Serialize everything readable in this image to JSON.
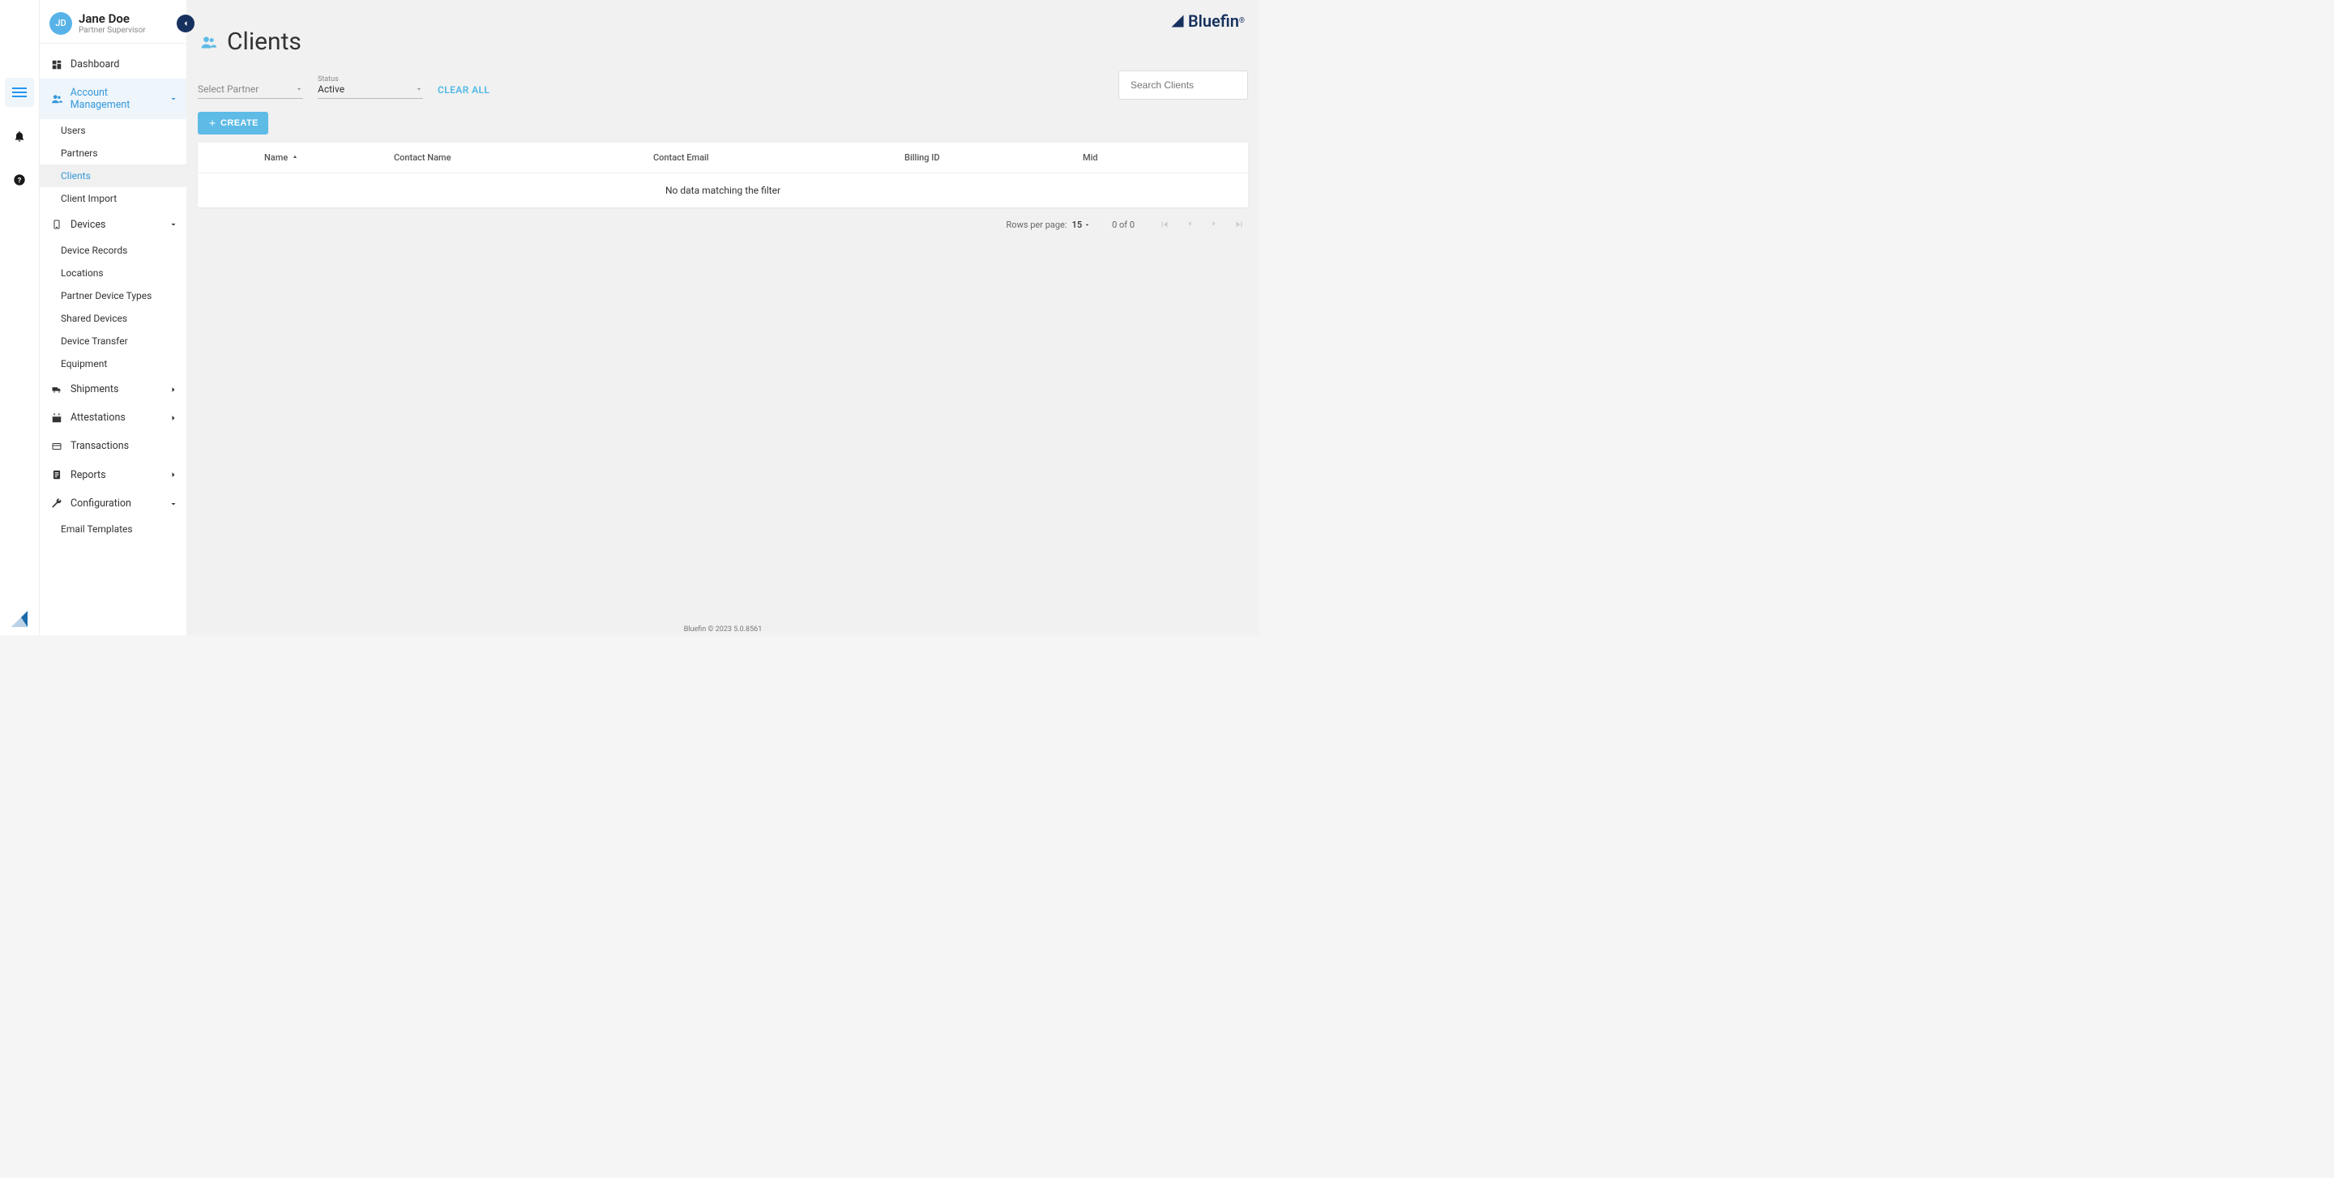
{
  "left_rail": {},
  "user": {
    "initials": "JD",
    "name": "Jane Doe",
    "role": "Partner Supervisor"
  },
  "sidebar": {
    "dashboard": "Dashboard",
    "account_mgmt": {
      "label": "Account Management",
      "items": [
        "Users",
        "Partners",
        "Clients",
        "Client Import"
      ]
    },
    "devices": {
      "label": "Devices",
      "items": [
        "Device Records",
        "Locations",
        "Partner Device Types",
        "Shared Devices",
        "Device Transfer",
        "Equipment"
      ]
    },
    "shipments": "Shipments",
    "attestations": "Attestations",
    "transactions": "Transactions",
    "reports": "Reports",
    "configuration": {
      "label": "Configuration",
      "items": [
        "Email Templates"
      ]
    }
  },
  "page": {
    "title": "Clients",
    "brand": "Bluefin"
  },
  "filters": {
    "partner_placeholder": "Select Partner",
    "status_label": "Status",
    "status_value": "Active",
    "clear_all": "CLEAR ALL",
    "search_placeholder": "Search Clients"
  },
  "actions": {
    "create": "CREATE"
  },
  "table": {
    "columns": {
      "name": "Name",
      "contact_name": "Contact Name",
      "contact_email": "Contact Email",
      "billing_id": "Billing ID",
      "mid": "Mid"
    },
    "empty": "No data matching the filter"
  },
  "pagination": {
    "rpp_label": "Rows per page:",
    "rpp_value": "15",
    "range": "0 of 0"
  },
  "footer": {
    "text": "Bluefin © 2023 5.0.8561"
  }
}
